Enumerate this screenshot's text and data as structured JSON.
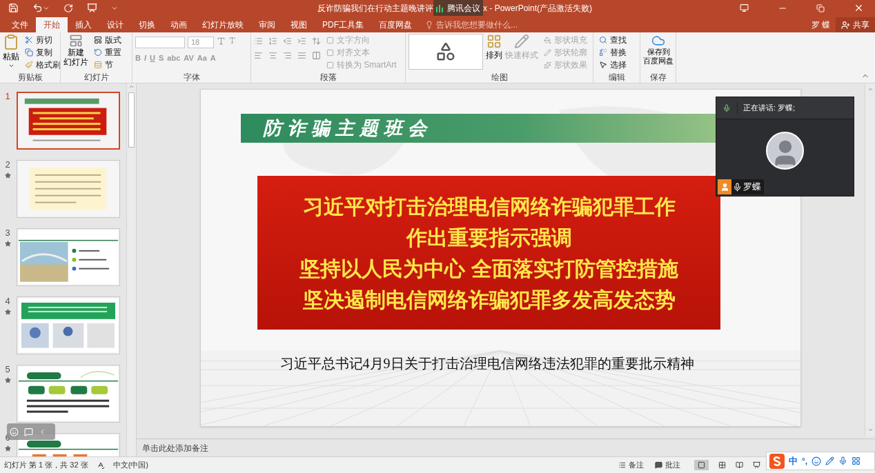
{
  "title_bar": {
    "title": "反诈防骗我们在行动主题晚讲评",
    "title_suffix": "x - PowerPoint(产品激活失败)",
    "meeting_badge": "腾讯会议"
  },
  "menu_tabs": [
    {
      "label": "文件",
      "selected": false
    },
    {
      "label": "开始",
      "selected": true
    },
    {
      "label": "插入",
      "selected": false
    },
    {
      "label": "设计",
      "selected": false
    },
    {
      "label": "切换",
      "selected": false
    },
    {
      "label": "动画",
      "selected": false
    },
    {
      "label": "幻灯片放映",
      "selected": false
    },
    {
      "label": "审阅",
      "selected": false
    },
    {
      "label": "视图",
      "selected": false
    },
    {
      "label": "PDF工具集",
      "selected": false
    },
    {
      "label": "百度网盘",
      "selected": false
    }
  ],
  "tell_me": "告诉我您想要做什么...",
  "user": "罗 蝶",
  "share": "共享",
  "ribbon": {
    "clipboard": {
      "title": "剪贴板",
      "paste": "粘贴",
      "items": [
        {
          "label": "剪切",
          "disabled": false
        },
        {
          "label": "复制",
          "disabled": false
        },
        {
          "label": "格式刷",
          "disabled": false
        }
      ]
    },
    "slides": {
      "title": "幻灯片",
      "new_slide": [
        "新建",
        "幻灯片"
      ],
      "items": [
        {
          "label": "版式",
          "disabled": false
        },
        {
          "label": "重置",
          "disabled": false
        },
        {
          "label": "节",
          "disabled": false
        }
      ]
    },
    "font": {
      "title": "字体",
      "font_size": "18",
      "format_buttons": [
        "B",
        "I",
        "U",
        "S",
        "abc",
        "AV",
        "Aa",
        "A"
      ]
    },
    "paragraph": {
      "title": "段落",
      "items": [
        {
          "label": "文字方向",
          "disabled": true
        },
        {
          "label": "对齐文本",
          "disabled": true
        },
        {
          "label": "转换为 SmartArt",
          "disabled": true
        }
      ]
    },
    "drawing": {
      "title": "绘图",
      "arrange": "排列",
      "quick_styles": {
        "label": "快速样式",
        "disabled": true
      },
      "items": [
        {
          "label": "形状填充",
          "disabled": true
        },
        {
          "label": "形状轮廓",
          "disabled": true
        },
        {
          "label": "形状效果",
          "disabled": true
        }
      ]
    },
    "editing": {
      "title": "编辑",
      "items": [
        {
          "label": "查找",
          "disabled": false
        },
        {
          "label": "替换",
          "disabled": false
        },
        {
          "label": "选择",
          "disabled": false
        }
      ]
    },
    "save": {
      "title": "保存",
      "button": [
        "保存到",
        "百度网盘"
      ]
    }
  },
  "thumbnails": [
    {
      "number": "1",
      "selected": true,
      "animated": false
    },
    {
      "number": "2",
      "selected": false,
      "animated": true
    },
    {
      "number": "3",
      "selected": false,
      "animated": true
    },
    {
      "number": "4",
      "selected": false,
      "animated": true
    },
    {
      "number": "5",
      "selected": false,
      "animated": true
    },
    {
      "number": "6",
      "selected": false,
      "animated": true
    }
  ],
  "slide": {
    "header": "防诈骗主题班会",
    "headline_lines": [
      "习近平对打击治理电信网络诈骗犯罪工作",
      "作出重要指示强调",
      "坚持以人民为中心 全面落实打防管控措施",
      "坚决遏制电信网络诈骗犯罪多发高发态势"
    ],
    "caption": "习近平总书记4月9日关于打击治理电信网络违法犯罪的重要批示精神"
  },
  "notes_placeholder": "单击此处添加备注",
  "status_bar": {
    "slide_info": "幻灯片 第 1 张，共 32 张",
    "language": "中文(中国)",
    "notes": "备注",
    "comments": "批注"
  },
  "video_call": {
    "speaking": "正在讲话: 罗蝶;",
    "participant": "罗蝶"
  },
  "ime_toolbar": {
    "mode": "中",
    "punctuation": "°,"
  }
}
